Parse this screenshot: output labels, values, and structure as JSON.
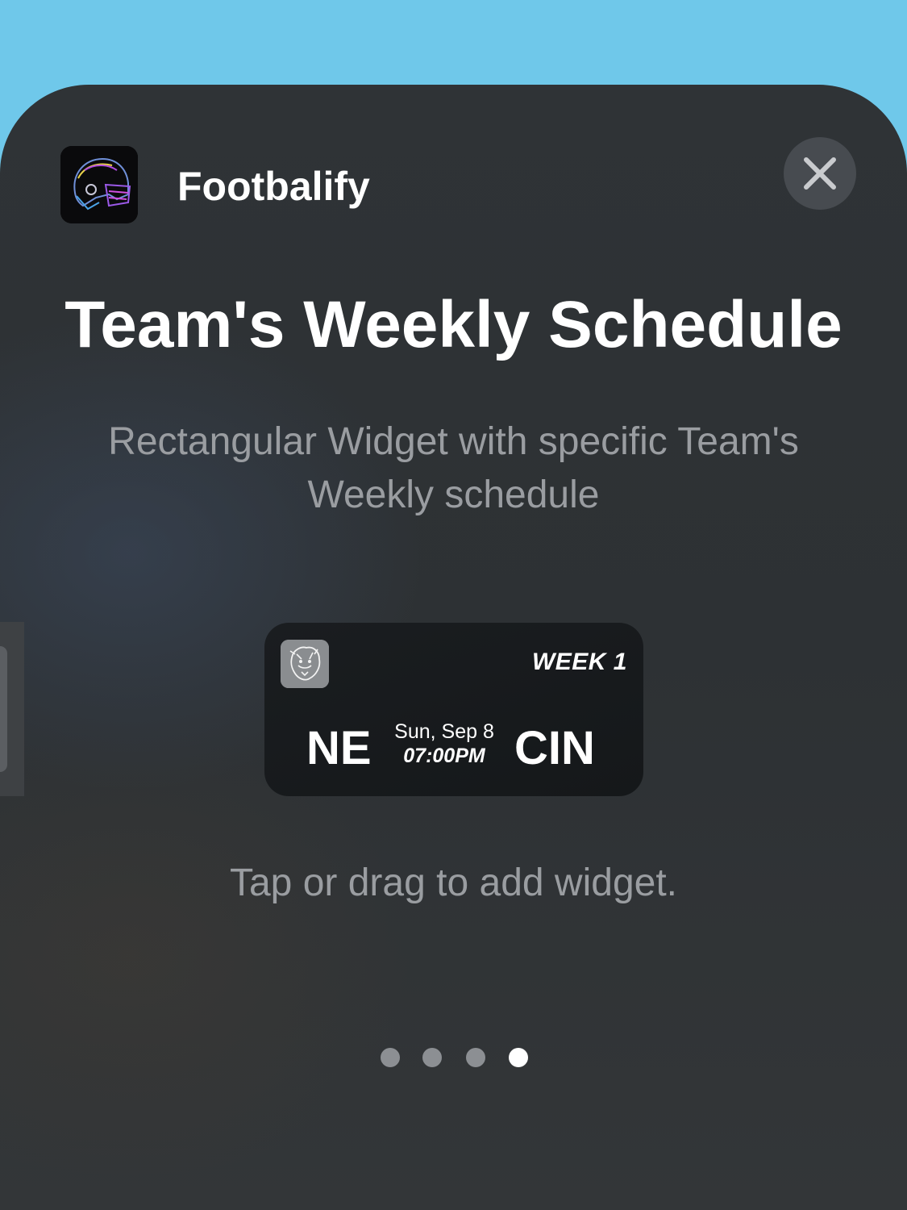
{
  "app": {
    "name": "Footbalify",
    "icon": "football-helmet-icon"
  },
  "close": {
    "icon": "close-icon"
  },
  "widget_gallery": {
    "title": "Team's Weekly Schedule",
    "description": "Rectangular Widget with specific Team's Weekly schedule",
    "hint": "Tap or drag to add widget.",
    "page_count": 4,
    "current_page": 4
  },
  "widget": {
    "team_logo": "tiger-logo-icon",
    "week": "WEEK 1",
    "home_team": "NE",
    "away_team": "CIN",
    "date": "Sun, Sep 8",
    "time": "07:00PM"
  },
  "colors": {
    "background": "#6fc8ea",
    "sheet": "#2f3336",
    "accent_helmet": "#7b3fe4"
  }
}
